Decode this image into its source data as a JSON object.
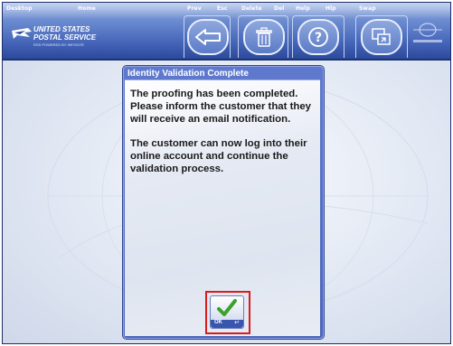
{
  "toolbar": {
    "desktop_label": "Desktop",
    "home_label": "Home",
    "prev_label": "Prev",
    "prev_key": "Esc",
    "delete_label": "Delete",
    "delete_key": "Del",
    "help_label": "Help",
    "help_key": "Hlp",
    "swap_label": "Swap",
    "icons": {
      "prev": "arrow-left-icon",
      "delete": "trash-icon",
      "help": "question-icon",
      "swap": "swap-windows-icon"
    }
  },
  "brand": {
    "line1": "UNITED STATES",
    "line2": "POSTAL SERVICE",
    "tagline": "RSS POWERED BY INFOSITE"
  },
  "dialog": {
    "title": "Identity Validation Complete",
    "message_lines_1": [
      "The proofing has been completed.",
      "Please inform the customer that they",
      "will receive an email notification."
    ],
    "message_lines_2": [
      "The customer can now log into their",
      "online account and continue the",
      "validation process."
    ],
    "ok_label": "OK",
    "ok_key": "↵"
  },
  "colors": {
    "toolbar": "#4666b9",
    "dialog_header": "#5670c8",
    "highlight": "#d91c1c",
    "check": "#3aa12a"
  }
}
